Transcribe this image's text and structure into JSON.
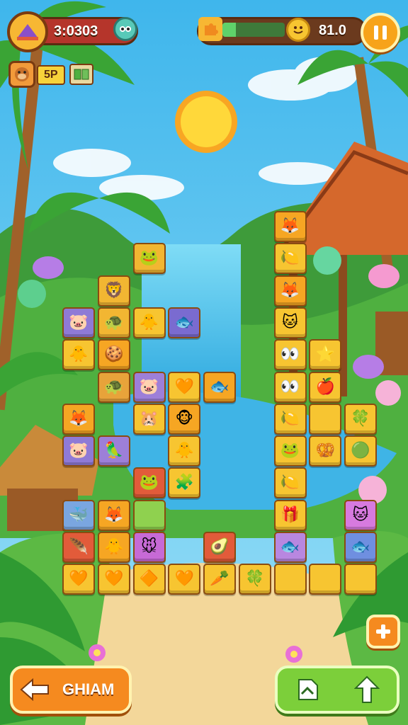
{
  "hud": {
    "score": "3:0303",
    "goal_value": "81.0",
    "level_badge": "5P",
    "icons": {
      "badge": "hat-badge-icon",
      "owl": "owl-mascot-icon",
      "progress": "puzzle-progress-icon",
      "coin": "smiley-coin-icon",
      "pause": "pause-icon",
      "monkey": "monkey-face-icon",
      "cards": "card-stack-icon"
    }
  },
  "board": {
    "tiles": [
      {
        "col": 6,
        "row": 0,
        "emoji": "🦊",
        "color": "#f6a623"
      },
      {
        "col": 2,
        "row": 1,
        "emoji": "🐸",
        "color": "#f2b632"
      },
      {
        "col": 6,
        "row": 1,
        "emoji": "🍋",
        "color": "#f7c531"
      },
      {
        "col": 1,
        "row": 2,
        "emoji": "🦁",
        "color": "#f2b632"
      },
      {
        "col": 6,
        "row": 2,
        "emoji": "🦊",
        "color": "#f6a623"
      },
      {
        "col": 0,
        "row": 3,
        "emoji": "🐷",
        "color": "#8f7ad6"
      },
      {
        "col": 1,
        "row": 3,
        "emoji": "🐢",
        "color": "#f2b632"
      },
      {
        "col": 2,
        "row": 3,
        "emoji": "🐥",
        "color": "#f7c531"
      },
      {
        "col": 3,
        "row": 3,
        "emoji": "🐟",
        "color": "#7a6bd0"
      },
      {
        "col": 6,
        "row": 3,
        "emoji": "🐱",
        "color": "#f7c531"
      },
      {
        "col": 0,
        "row": 4,
        "emoji": "🐥",
        "color": "#f7c531"
      },
      {
        "col": 1,
        "row": 4,
        "emoji": "🍪",
        "color": "#f6a623"
      },
      {
        "col": 6,
        "row": 4,
        "emoji": "👀",
        "color": "#f7c531"
      },
      {
        "col": 7,
        "row": 4,
        "emoji": "⭐",
        "color": "#f7c531"
      },
      {
        "col": 1,
        "row": 5,
        "emoji": "🐢",
        "color": "#e8a33a"
      },
      {
        "col": 2,
        "row": 5,
        "emoji": "🐷",
        "color": "#9d7fd8"
      },
      {
        "col": 3,
        "row": 5,
        "emoji": "🧡",
        "color": "#f7c531"
      },
      {
        "col": 4,
        "row": 5,
        "emoji": "🐟",
        "color": "#f6a623"
      },
      {
        "col": 6,
        "row": 5,
        "emoji": "👀",
        "color": "#f7c531"
      },
      {
        "col": 7,
        "row": 5,
        "emoji": "🍎",
        "color": "#f7c531"
      },
      {
        "col": 0,
        "row": 6,
        "emoji": "🦊",
        "color": "#f6a623"
      },
      {
        "col": 2,
        "row": 6,
        "emoji": "🐹",
        "color": "#f7c531"
      },
      {
        "col": 3,
        "row": 6,
        "emoji": "🐵",
        "color": "#f6a623"
      },
      {
        "col": 6,
        "row": 6,
        "emoji": "🍋",
        "color": "#f7c531"
      },
      {
        "col": 7,
        "row": 6,
        "emoji": "",
        "color": "#f7c531"
      },
      {
        "col": 8,
        "row": 6,
        "emoji": "🍀",
        "color": "#f7c531"
      },
      {
        "col": 0,
        "row": 7,
        "emoji": "🐷",
        "color": "#8f7ad6"
      },
      {
        "col": 1,
        "row": 7,
        "emoji": "🦜",
        "color": "#9d7fd8"
      },
      {
        "col": 3,
        "row": 7,
        "emoji": "🐥",
        "color": "#f7c531"
      },
      {
        "col": 6,
        "row": 7,
        "emoji": "🐸",
        "color": "#f7c531"
      },
      {
        "col": 7,
        "row": 7,
        "emoji": "🥨",
        "color": "#f7c531"
      },
      {
        "col": 8,
        "row": 7,
        "emoji": "🟢",
        "color": "#f7c531"
      },
      {
        "col": 2,
        "row": 8,
        "emoji": "🐸",
        "color": "#e25b3a"
      },
      {
        "col": 3,
        "row": 8,
        "emoji": "🧩",
        "color": "#f7c531"
      },
      {
        "col": 6,
        "row": 8,
        "emoji": "🍋",
        "color": "#f7c531"
      },
      {
        "col": 0,
        "row": 9,
        "emoji": "🐳",
        "color": "#7aa6e0"
      },
      {
        "col": 1,
        "row": 9,
        "emoji": "🦊",
        "color": "#f6a623"
      },
      {
        "col": 2,
        "row": 9,
        "emoji": "",
        "color": "#8fd14f"
      },
      {
        "col": 6,
        "row": 9,
        "emoji": "🎁",
        "color": "#f7c531"
      },
      {
        "col": 8,
        "row": 9,
        "emoji": "🐱",
        "color": "#d77adf"
      },
      {
        "col": 0,
        "row": 10,
        "emoji": "🪶",
        "color": "#e25b3a"
      },
      {
        "col": 1,
        "row": 10,
        "emoji": "🐥",
        "color": "#f6a623"
      },
      {
        "col": 2,
        "row": 10,
        "emoji": "🐭",
        "color": "#c76ad6"
      },
      {
        "col": 4,
        "row": 10,
        "emoji": "🥑",
        "color": "#e25b3a"
      },
      {
        "col": 6,
        "row": 10,
        "emoji": "🐟",
        "color": "#b887e0"
      },
      {
        "col": 8,
        "row": 10,
        "emoji": "🐟",
        "color": "#6f8fe0"
      },
      {
        "col": 0,
        "row": 11,
        "emoji": "🧡",
        "color": "#f7c531"
      },
      {
        "col": 1,
        "row": 11,
        "emoji": "🧡",
        "color": "#f7c531"
      },
      {
        "col": 2,
        "row": 11,
        "emoji": "🔶",
        "color": "#f7c531"
      },
      {
        "col": 3,
        "row": 11,
        "emoji": "🧡",
        "color": "#f7c531"
      },
      {
        "col": 4,
        "row": 11,
        "emoji": "🥕",
        "color": "#f7c531"
      },
      {
        "col": 5,
        "row": 11,
        "emoji": "🍀",
        "color": "#f7c531"
      },
      {
        "col": 6,
        "row": 11,
        "emoji": "",
        "color": "#f7c531"
      },
      {
        "col": 7,
        "row": 11,
        "emoji": "",
        "color": "#f7c531"
      },
      {
        "col": 8,
        "row": 11,
        "emoji": "",
        "color": "#f7c531"
      }
    ]
  },
  "buttons": {
    "back": {
      "label": "GHIAM",
      "icon": "arrow-left-icon",
      "color": "#f58a1f"
    },
    "right_group": {
      "icons": [
        "document-icon",
        "arrow-up-icon"
      ],
      "color": "#7ccf3a"
    },
    "add": {
      "icon": "plus-icon",
      "color": "#f58a1f"
    }
  },
  "colors": {
    "sky": "#5fc8f0",
    "water": "#3fb4e6",
    "sand": "#f3d79a",
    "grass": "#4caf3c",
    "hud_bar": "#6b3a1e",
    "gold": "#f7b733"
  }
}
